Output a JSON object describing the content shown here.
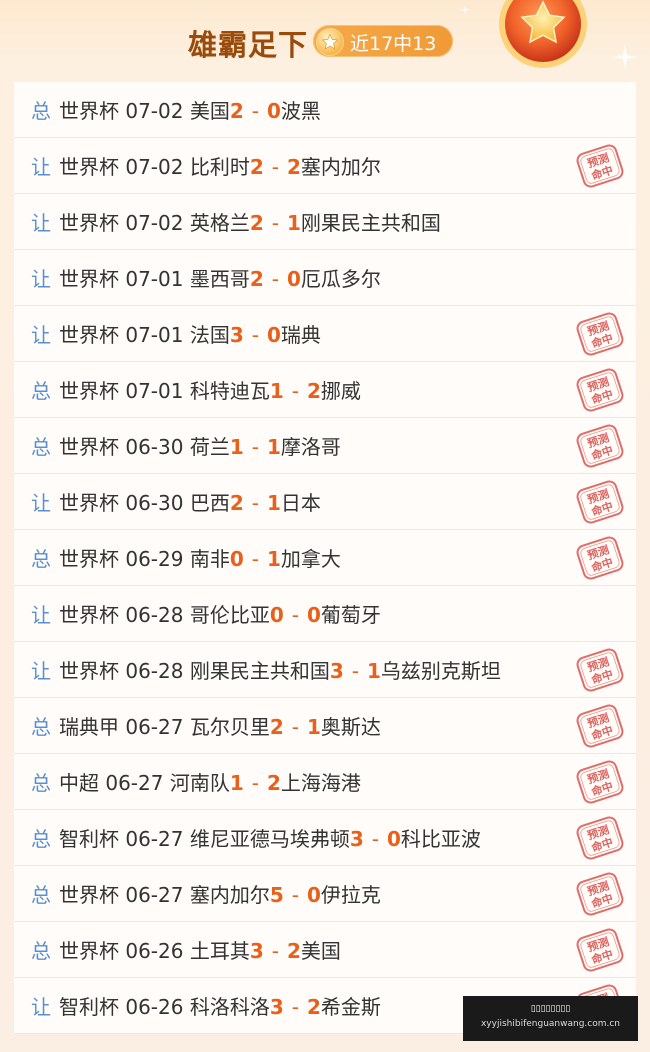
{
  "header": {
    "title": "雄霸足下",
    "record": "近17中13",
    "medal_icon": "star-medal-icon"
  },
  "stamp_text": "预测命中",
  "colors": {
    "bet_type": "#5a8fd0",
    "score": "#e8601a",
    "stamp": "#d9534f",
    "title": "#9a4a0a"
  },
  "matches": [
    {
      "type": "总",
      "league": "世界杯",
      "date": "07-02",
      "home": "美国",
      "home_score": "2",
      "away_score": "0",
      "away": "波黑",
      "hit": false
    },
    {
      "type": "让",
      "league": "世界杯",
      "date": "07-02",
      "home": "比利时",
      "home_score": "2",
      "away_score": "2",
      "away": "塞内加尔",
      "hit": true
    },
    {
      "type": "让",
      "league": "世界杯",
      "date": "07-02",
      "home": "英格兰",
      "home_score": "2",
      "away_score": "1",
      "away": "刚果民主共和国",
      "hit": false
    },
    {
      "type": "让",
      "league": "世界杯",
      "date": "07-01",
      "home": "墨西哥",
      "home_score": "2",
      "away_score": "0",
      "away": "厄瓜多尔",
      "hit": false
    },
    {
      "type": "让",
      "league": "世界杯",
      "date": "07-01",
      "home": "法国",
      "home_score": "3",
      "away_score": "0",
      "away": "瑞典",
      "hit": true
    },
    {
      "type": "总",
      "league": "世界杯",
      "date": "07-01",
      "home": "科特迪瓦",
      "home_score": "1",
      "away_score": "2",
      "away": "挪威",
      "hit": true
    },
    {
      "type": "总",
      "league": "世界杯",
      "date": "06-30",
      "home": "荷兰",
      "home_score": "1",
      "away_score": "1",
      "away": "摩洛哥",
      "hit": true
    },
    {
      "type": "让",
      "league": "世界杯",
      "date": "06-30",
      "home": "巴西",
      "home_score": "2",
      "away_score": "1",
      "away": "日本",
      "hit": true
    },
    {
      "type": "总",
      "league": "世界杯",
      "date": "06-29",
      "home": "南非",
      "home_score": "0",
      "away_score": "1",
      "away": "加拿大",
      "hit": true
    },
    {
      "type": "让",
      "league": "世界杯",
      "date": "06-28",
      "home": "哥伦比亚",
      "home_score": "0",
      "away_score": "0",
      "away": "葡萄牙",
      "hit": false
    },
    {
      "type": "让",
      "league": "世界杯",
      "date": "06-28",
      "home": "刚果民主共和国",
      "home_score": "3",
      "away_score": "1",
      "away": "乌兹别克斯坦",
      "hit": true
    },
    {
      "type": "总",
      "league": "瑞典甲",
      "date": "06-27",
      "home": "瓦尔贝里",
      "home_score": "2",
      "away_score": "1",
      "away": "奥斯达",
      "hit": true
    },
    {
      "type": "总",
      "league": "中超",
      "date": "06-27",
      "home": "河南队",
      "home_score": "1",
      "away_score": "2",
      "away": "上海海港",
      "hit": true
    },
    {
      "type": "总",
      "league": "智利杯",
      "date": "06-27",
      "home": "维尼亚德马埃弗顿",
      "home_score": "3",
      "away_score": "0",
      "away": "科比亚波",
      "hit": true
    },
    {
      "type": "总",
      "league": "世界杯",
      "date": "06-27",
      "home": "塞内加尔",
      "home_score": "5",
      "away_score": "0",
      "away": "伊拉克",
      "hit": true
    },
    {
      "type": "总",
      "league": "世界杯",
      "date": "06-26",
      "home": "土耳其",
      "home_score": "3",
      "away_score": "2",
      "away": "美国",
      "hit": true
    },
    {
      "type": "让",
      "league": "智利杯",
      "date": "06-26",
      "home": "科洛科洛",
      "home_score": "3",
      "away_score": "2",
      "away": "希金斯",
      "hit": true
    }
  ],
  "watermark": {
    "line1": "▯▯▯▯▯▯▯▯",
    "line2": "xyyjishibifenguanwang.com.cn"
  }
}
